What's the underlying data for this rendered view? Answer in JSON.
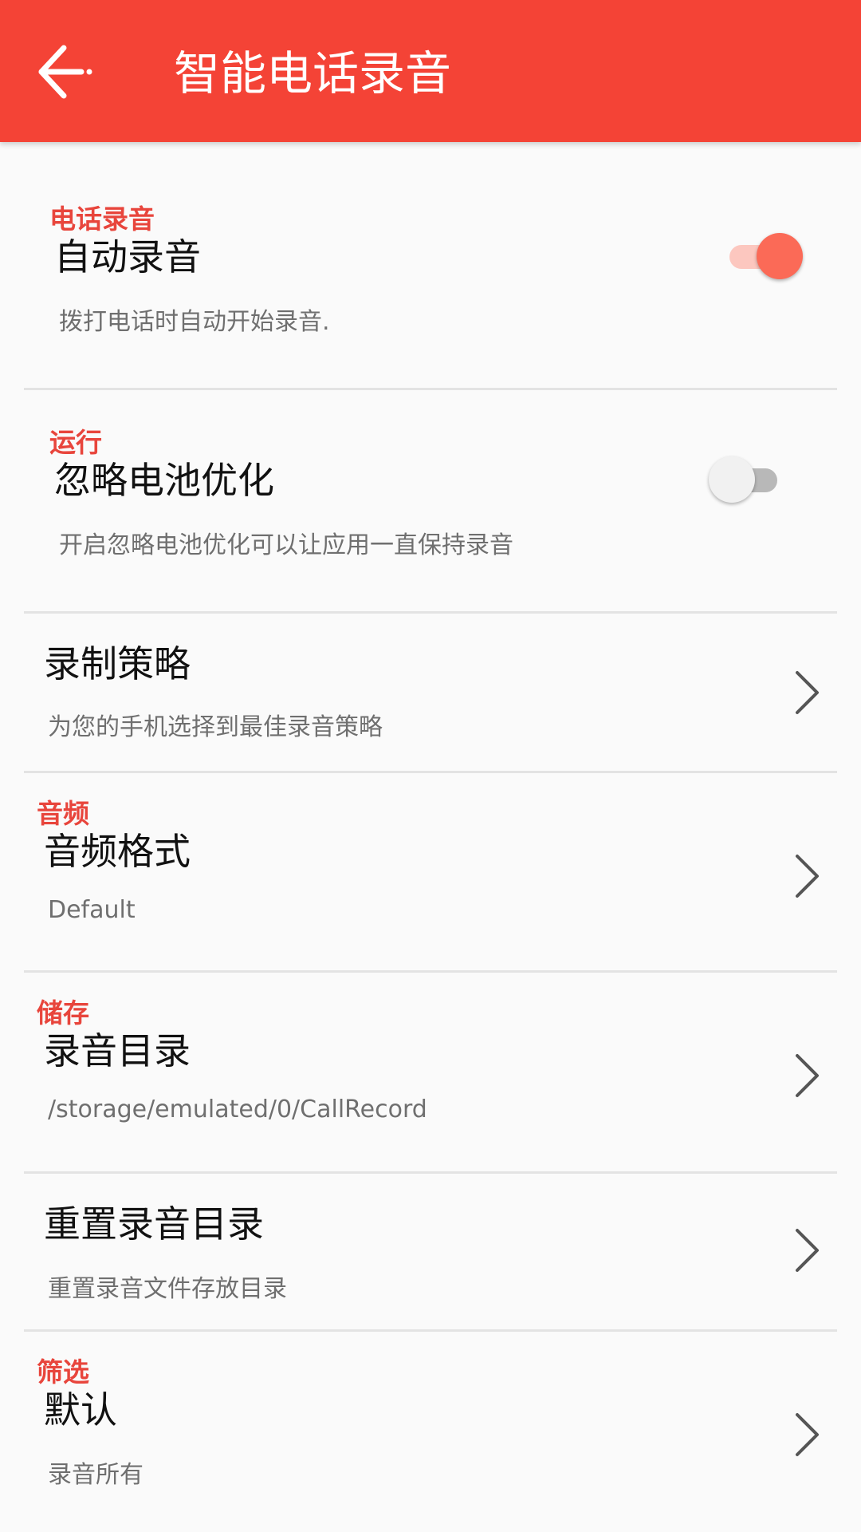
{
  "appbar": {
    "title": "智能电话录音",
    "color": "#f44336",
    "back_icon": "arrow-left-icon"
  },
  "accent_color": "#e8453c",
  "sections": {
    "call_recording": {
      "label": "电话录音"
    },
    "running": {
      "label": "运行"
    },
    "audio": {
      "label": "音频"
    },
    "storage": {
      "label": "储存"
    },
    "filter": {
      "label": "筛选"
    }
  },
  "items": {
    "auto_record": {
      "title": "自动录音",
      "summary": "拨打电话时自动开始录音.",
      "enabled": true
    },
    "battery_opt": {
      "title": "忽略电池优化",
      "summary": "开启忽略电池优化可以让应用一直保持录音",
      "enabled": false
    },
    "strategy": {
      "title": "录制策略",
      "summary": "为您的手机选择到最佳录音策略",
      "icon": "chevron-right-icon"
    },
    "audio_format": {
      "title": "音频格式",
      "summary": "Default",
      "icon": "chevron-right-icon"
    },
    "record_dir": {
      "title": "录音目录",
      "summary": "/storage/emulated/0/CallRecord",
      "icon": "chevron-right-icon"
    },
    "reset_dir": {
      "title": "重置录音目录",
      "summary": "重置录音文件存放目录",
      "icon": "chevron-right-icon"
    },
    "filter_default": {
      "title": "默认",
      "summary": "录音所有",
      "icon": "chevron-right-icon"
    }
  }
}
